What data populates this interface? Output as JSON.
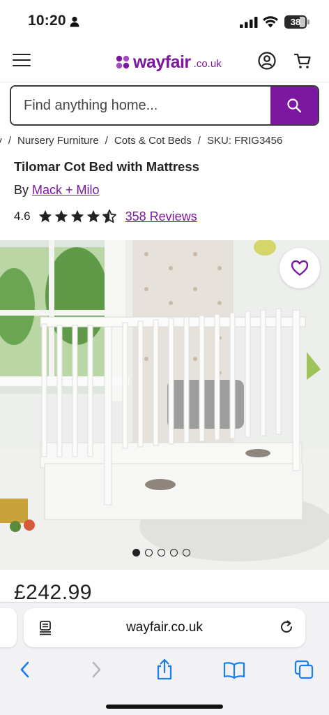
{
  "status_bar": {
    "time": "10:20",
    "battery_level": "38",
    "icons": [
      "person-icon",
      "cellular-signal-icon",
      "wifi-icon",
      "battery-icon"
    ]
  },
  "header": {
    "logo_text": "wayfair",
    "logo_tld": ".co.uk",
    "brand_color": "#7b189f",
    "icons": [
      "menu-icon",
      "account-icon",
      "cart-icon"
    ]
  },
  "search": {
    "placeholder": "Find anything home...",
    "value": ""
  },
  "breadcrumb": {
    "items": [
      "ery",
      "Nursery Furniture",
      "Cots & Cot Beds"
    ],
    "separator": "/",
    "sku": "SKU: FRIG3456"
  },
  "product": {
    "title": "Tilomar Cot Bed with Mattress",
    "by_label": "By",
    "brand": "Mack + Milo",
    "rating": "4.6",
    "rating_value": 4.6,
    "rating_max": 5,
    "reviews_label": "358 Reviews",
    "price": "£242.99",
    "image_count": 5,
    "active_image": 1
  },
  "safari": {
    "address": "wayfair.co.uk",
    "accent_color": "#1a7cf0",
    "toolbar_icons": [
      "back-icon",
      "forward-icon",
      "share-icon",
      "bookmarks-icon",
      "tabs-icon"
    ]
  }
}
